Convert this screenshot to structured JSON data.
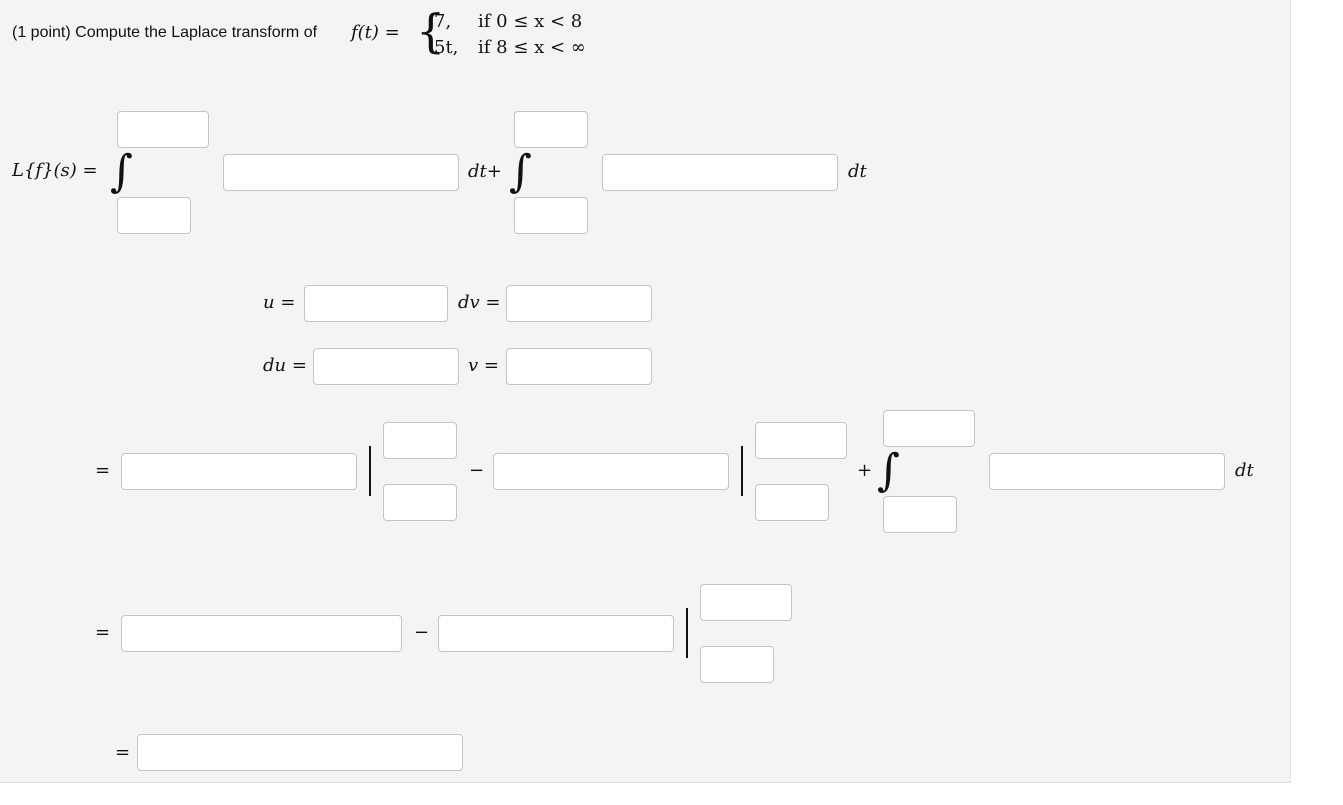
{
  "problem": {
    "prefix": "(1 point) Compute the Laplace transform of",
    "func_lhs": "f(t) =",
    "case1_value": "7,",
    "case1_cond": "if 0 ≤ x < 8",
    "case2_value": "5t,",
    "case2_cond": "if 8 ≤ x < ∞"
  },
  "row1": {
    "lhs": "L{f}(s) =",
    "integral_symbol": "∫",
    "mid_dt": "dt+",
    "end_dt": "dt"
  },
  "parts": {
    "u_label": "u =",
    "dv_label": "dv =",
    "du_label": "du =",
    "v_label": "v ="
  },
  "row3": {
    "eq": "=",
    "minus": "−",
    "plus": "+",
    "end_dt": "dt"
  },
  "row4": {
    "eq": "=",
    "minus": "−"
  },
  "row5": {
    "eq": "="
  }
}
